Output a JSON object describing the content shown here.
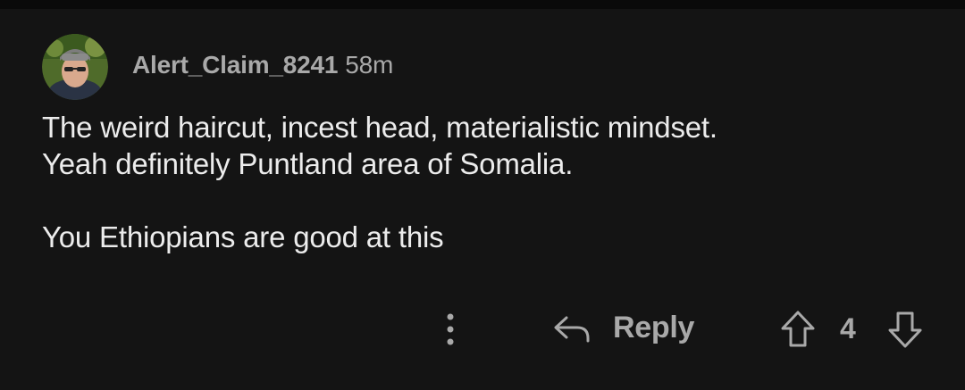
{
  "comment": {
    "author": "Alert_Claim_8241",
    "time": "58m",
    "paragraphs": [
      "The weird haircut, incest head, materialistic mindset.",
      "Yeah definitely Puntland area of Somalia.",
      "You Ethiopians are good at this"
    ],
    "avatar_icon": "avatar-icon"
  },
  "actions": {
    "more_icon": "more-options-icon",
    "reply_icon": "reply-arrow-icon",
    "reply_label": "Reply",
    "upvote_icon": "upvote-arrow-icon",
    "score": "4",
    "downvote_icon": "downvote-arrow-icon"
  },
  "colors": {
    "background": "#141414",
    "text": "#ececec",
    "muted": "#a9a9a9"
  }
}
